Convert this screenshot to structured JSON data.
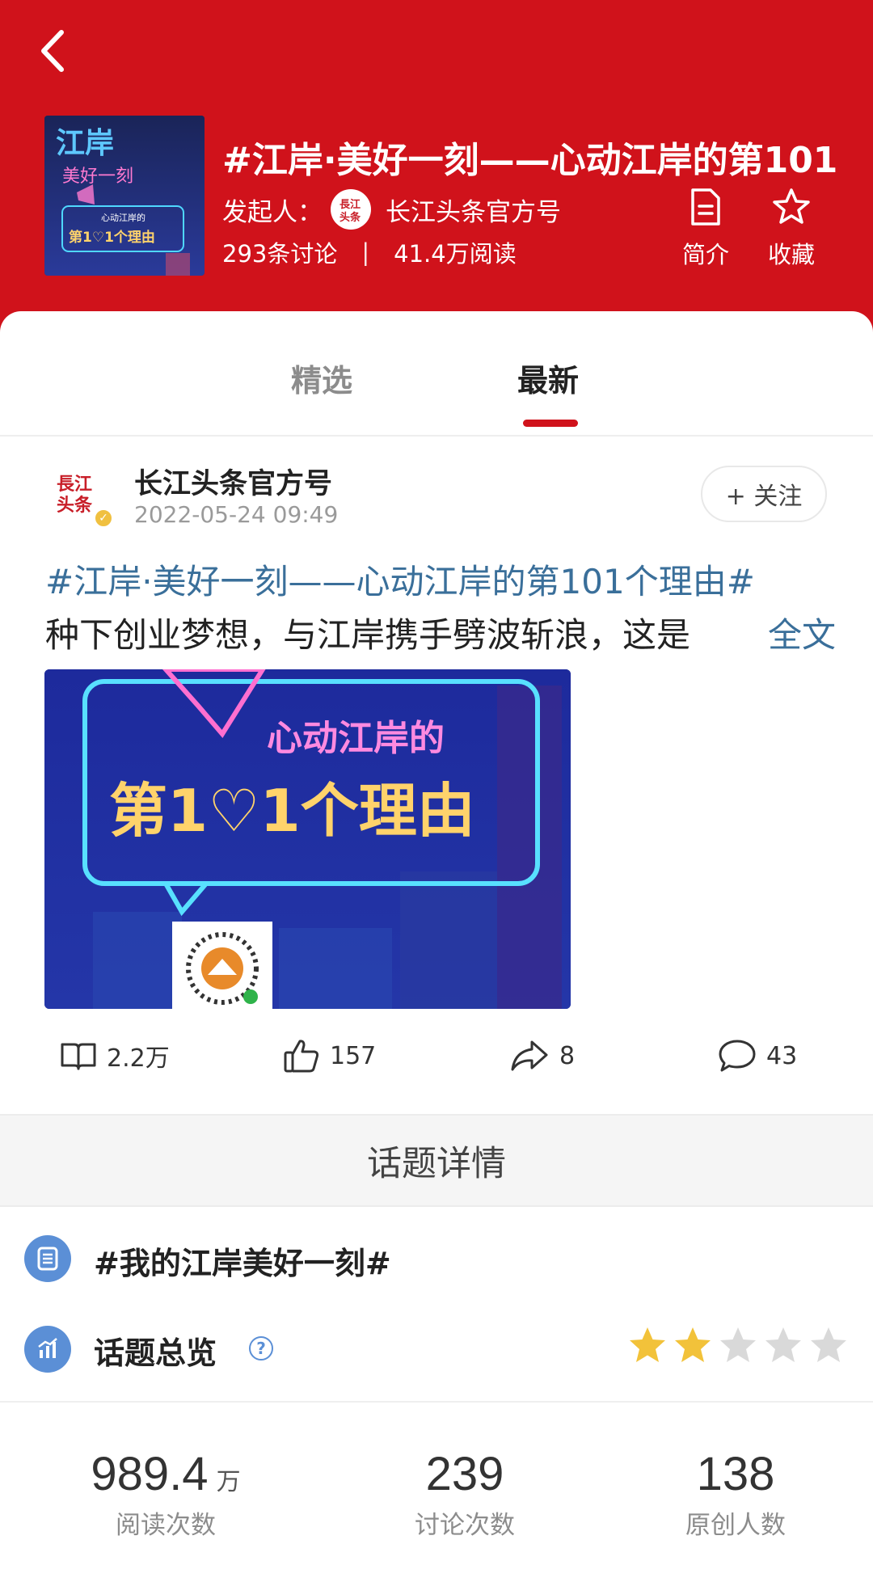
{
  "header": {
    "title": "#江岸·美好一刻——心动江岸的第101",
    "initiator_label": "发起人：",
    "initiator_name": "长江头条官方号",
    "discussions": "293条讨论",
    "separator": "|",
    "reads": "41.4万阅读",
    "intro_label": "简介",
    "favorite_label": "收藏"
  },
  "cover": {
    "line1": "江岸",
    "line2": "美好一刻",
    "line3": "心动江岸的",
    "line4": "第1♡1个理由"
  },
  "tabs": [
    {
      "label": "精选"
    },
    {
      "label": "最新"
    }
  ],
  "post": {
    "author": "长江头条官方号",
    "time": "2022-05-24 09:49",
    "follow_label": "+ 关注",
    "line1": "#江岸·美好一刻——心动江岸的第101个理由#",
    "line2": "种下创业梦想，与江岸携手劈波斩浪，这是",
    "fulltext_label": "全文",
    "image_line1": "心动江岸的",
    "image_line2": "第1♡1个理由",
    "reads": "2.2万",
    "likes": "157",
    "shares": "8",
    "comments": "43"
  },
  "detail": {
    "label": "话题详情",
    "topic_name": "#我的江岸美好一刻#",
    "overview_label": "话题总览",
    "rating": 2,
    "rating_max": 5
  },
  "metrics": [
    {
      "value": "989.4",
      "unit": "万",
      "label": "阅读次数"
    },
    {
      "value": "239",
      "unit": "",
      "label": "讨论次数"
    },
    {
      "value": "138",
      "unit": "",
      "label": "原创人数"
    }
  ],
  "colors": {
    "brand_red": "#d0121b",
    "link_blue": "#3a6f9a",
    "icon_blue": "#5b8fd6",
    "star_gold": "#f2c23a",
    "star_gray": "#d9d9d9"
  }
}
